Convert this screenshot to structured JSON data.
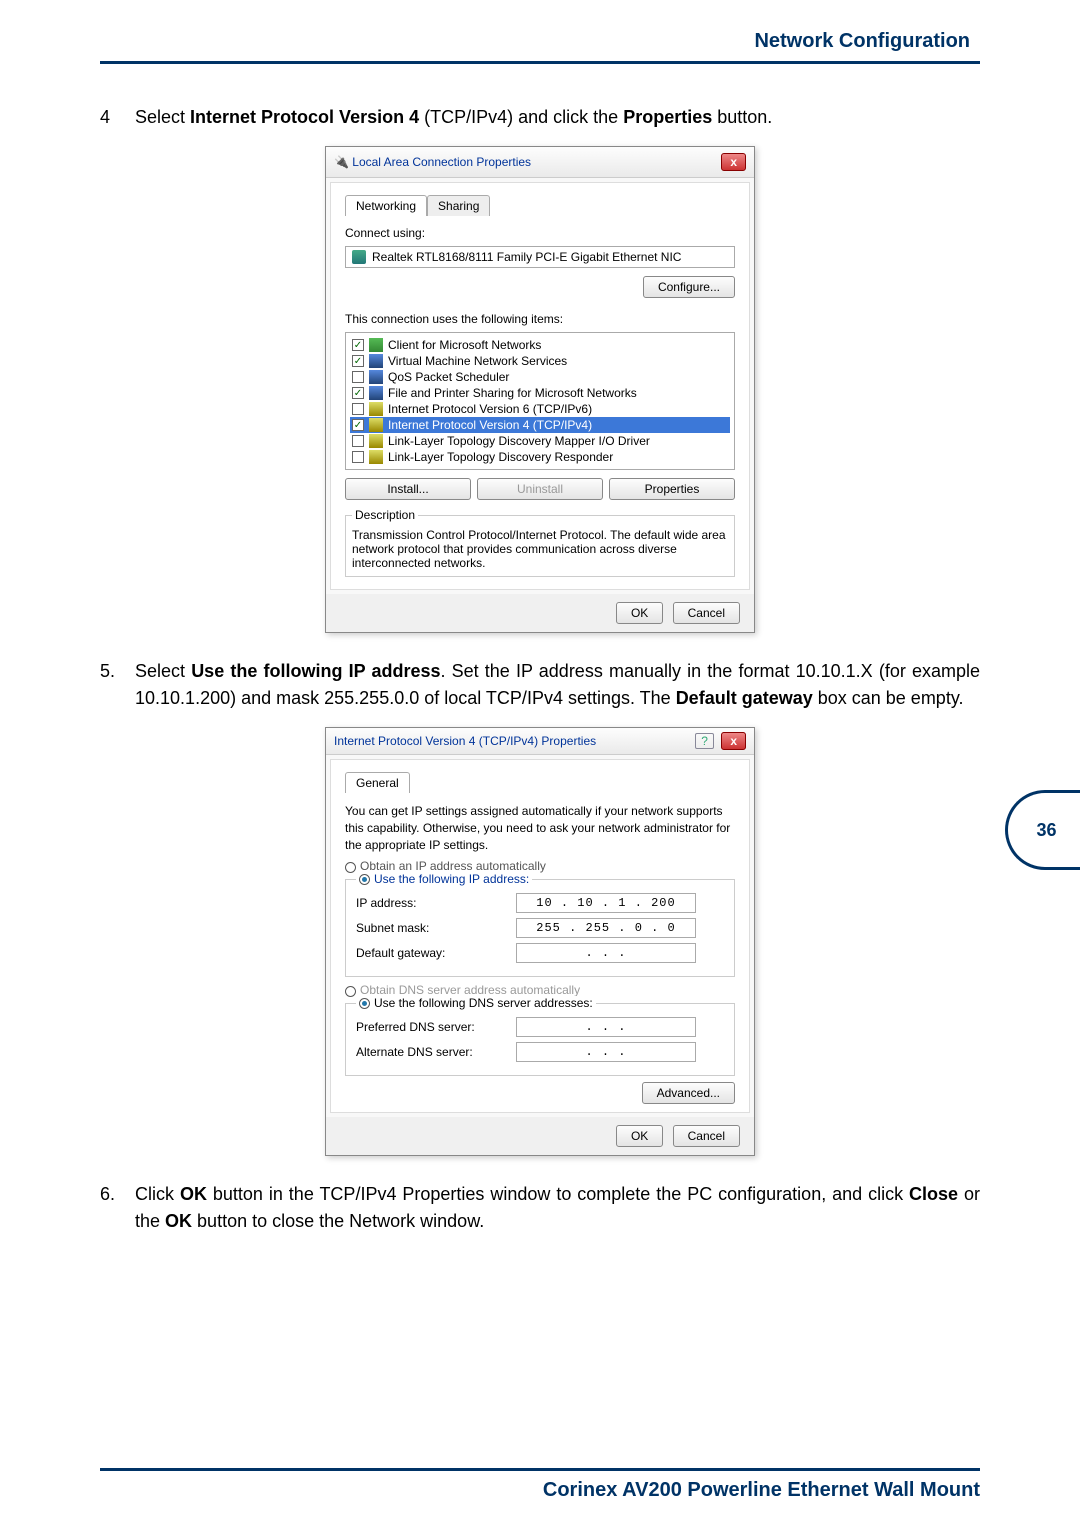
{
  "header": {
    "title": "Network Configuration"
  },
  "page_number": "36",
  "footer": "Corinex AV200 Powerline Ethernet Wall Mount",
  "step4": {
    "num": "4",
    "pre": "Select ",
    "bold1": "Internet Protocol Version 4",
    "mid": " (TCP/IPv4) and click the ",
    "bold2": "Properties",
    "post": " button."
  },
  "dialog1": {
    "title": "Local Area Connection Properties",
    "close": "x",
    "tab_networking": "Networking",
    "tab_sharing": "Sharing",
    "connect_using": "Connect using:",
    "adapter": "Realtek RTL8168/8111 Family PCI-E Gigabit Ethernet NIC",
    "configure": "Configure...",
    "uses_label": "This connection uses the following items:",
    "items": [
      {
        "checked": true,
        "icon": "icon-green",
        "label": "Client for Microsoft Networks"
      },
      {
        "checked": true,
        "icon": "icon-blue",
        "label": "Virtual Machine Network Services"
      },
      {
        "checked": false,
        "icon": "icon-blue",
        "label": "QoS Packet Scheduler"
      },
      {
        "checked": true,
        "icon": "icon-blue",
        "label": "File and Printer Sharing for Microsoft Networks"
      },
      {
        "checked": false,
        "icon": "icon-yellow",
        "label": "Internet Protocol Version 6 (TCP/IPv6)"
      },
      {
        "checked": true,
        "icon": "icon-yellow",
        "label": "Internet Protocol Version 4 (TCP/IPv4)",
        "selected": true
      },
      {
        "checked": false,
        "icon": "icon-yellow",
        "label": "Link-Layer Topology Discovery Mapper I/O Driver"
      },
      {
        "checked": false,
        "icon": "icon-yellow",
        "label": "Link-Layer Topology Discovery Responder"
      }
    ],
    "install": "Install...",
    "uninstall": "Uninstall",
    "properties": "Properties",
    "desc_legend": "Description",
    "desc": "Transmission Control Protocol/Internet Protocol. The default wide area network protocol that provides communication across diverse interconnected networks.",
    "ok": "OK",
    "cancel": "Cancel"
  },
  "step5": {
    "num": "5.",
    "pre": "Select ",
    "bold1": "Use the following IP address",
    "mid": ". Set the IP address manually in the format 10.10.1.X (for example 10.10.1.200) and mask 255.255.0.0 of local TCP/IPv4 settings. The ",
    "bold2": "Default gateway",
    "post": " box can be empty."
  },
  "dialog2": {
    "title": "Internet Protocol Version 4 (TCP/IPv4) Properties",
    "help": "?",
    "close": "x",
    "tab_general": "General",
    "intro": "You can get IP settings assigned automatically if your network supports this capability. Otherwise, you need to ask your network administrator for the appropriate IP settings.",
    "radio_auto_ip": "Obtain an IP address automatically",
    "radio_manual_ip": "Use the following IP address:",
    "ip_label": "IP address:",
    "ip_value": "10 . 10 .  1 . 200",
    "mask_label": "Subnet mask:",
    "mask_value": "255 . 255 .  0 .  0",
    "gw_label": "Default gateway:",
    "gw_value": ".     .     .",
    "radio_auto_dns": "Obtain DNS server address automatically",
    "radio_manual_dns": "Use the following DNS server addresses:",
    "pref_dns_label": "Preferred DNS server:",
    "pref_dns_value": ".     .     .",
    "alt_dns_label": "Alternate DNS server:",
    "alt_dns_value": ".     .     .",
    "advanced": "Advanced...",
    "ok": "OK",
    "cancel": "Cancel"
  },
  "step6": {
    "num": "6.",
    "pre": "Click ",
    "bold1": "OK",
    "mid": " button in the TCP/IPv4 Properties window to complete the PC configuration, and click ",
    "bold2": "Close",
    "mid2": " or the ",
    "bold3": "OK",
    "post": " button to close the Network window."
  }
}
